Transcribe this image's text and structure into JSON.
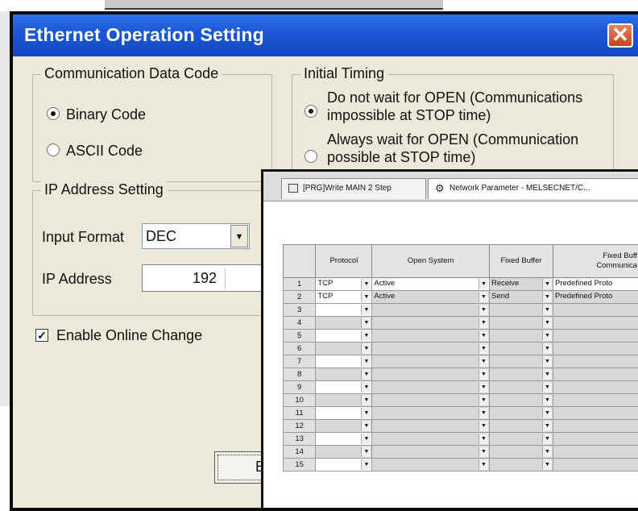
{
  "dialog": {
    "title": "Ethernet Operation Setting",
    "close_glyph": "✕"
  },
  "communication_data_code": {
    "legend": "Communication Data Code",
    "options": [
      {
        "label": "Binary Code",
        "selected": true
      },
      {
        "label": "ASCII Code",
        "selected": false
      }
    ]
  },
  "initial_timing": {
    "legend": "Initial Timing",
    "options": [
      {
        "line1": "Do not wait for OPEN (Communications",
        "line2": "impossible at STOP time)",
        "selected": true
      },
      {
        "line1": "Always wait for OPEN (Communication",
        "line2": "possible at STOP time)",
        "selected": false
      }
    ]
  },
  "ip_address_setting": {
    "legend": "IP Address Setting",
    "input_format_label": "Input Format",
    "input_format_value": "DEC",
    "ip_address_label": "IP Address",
    "ip_first_octet": "192"
  },
  "enable_online_change": {
    "label": "Enable Online Change",
    "checked": true
  },
  "end_button_partial": "E",
  "network_window": {
    "tabs": [
      {
        "label": "[PRG]Write MAIN 2 Step",
        "icon": "program-icon"
      },
      {
        "label": "Network Parameter - MELSECNET/C...",
        "icon": "network-icon"
      }
    ],
    "columns": [
      "",
      "Protocol",
      "Open System",
      "Fixed Buffer",
      "Fixed Buffer Communication"
    ],
    "column_header_visible": [
      "",
      "Protocol",
      "Open System",
      "Fixed Buffer",
      "Fixed Buff\nCommunica"
    ],
    "rows": [
      {
        "no": "1",
        "protocol": "TCP",
        "open_system": "Active",
        "fixed_buffer": "Receive",
        "fixed_buffer_comm": "Predefined Proto"
      },
      {
        "no": "2",
        "protocol": "TCP",
        "open_system": "Active",
        "fixed_buffer": "Send",
        "fixed_buffer_comm": "Predefined Proto"
      },
      {
        "no": "3",
        "protocol": "",
        "open_system": "",
        "fixed_buffer": "",
        "fixed_buffer_comm": ""
      },
      {
        "no": "4",
        "protocol": "",
        "open_system": "",
        "fixed_buffer": "",
        "fixed_buffer_comm": ""
      },
      {
        "no": "5",
        "protocol": "",
        "open_system": "",
        "fixed_buffer": "",
        "fixed_buffer_comm": ""
      },
      {
        "no": "6",
        "protocol": "",
        "open_system": "",
        "fixed_buffer": "",
        "fixed_buffer_comm": ""
      },
      {
        "no": "7",
        "protocol": "",
        "open_system": "",
        "fixed_buffer": "",
        "fixed_buffer_comm": ""
      },
      {
        "no": "8",
        "protocol": "",
        "open_system": "",
        "fixed_buffer": "",
        "fixed_buffer_comm": ""
      },
      {
        "no": "9",
        "protocol": "",
        "open_system": "",
        "fixed_buffer": "",
        "fixed_buffer_comm": ""
      },
      {
        "no": "10",
        "protocol": "",
        "open_system": "",
        "fixed_buffer": "",
        "fixed_buffer_comm": ""
      },
      {
        "no": "11",
        "protocol": "",
        "open_system": "",
        "fixed_buffer": "",
        "fixed_buffer_comm": ""
      },
      {
        "no": "12",
        "protocol": "",
        "open_system": "",
        "fixed_buffer": "",
        "fixed_buffer_comm": ""
      },
      {
        "no": "13",
        "protocol": "",
        "open_system": "",
        "fixed_buffer": "",
        "fixed_buffer_comm": ""
      },
      {
        "no": "14",
        "protocol": "",
        "open_system": "",
        "fixed_buffer": "",
        "fixed_buffer_comm": ""
      },
      {
        "no": "15",
        "protocol": "",
        "open_system": "",
        "fixed_buffer": "",
        "fixed_buffer_comm": ""
      }
    ]
  }
}
